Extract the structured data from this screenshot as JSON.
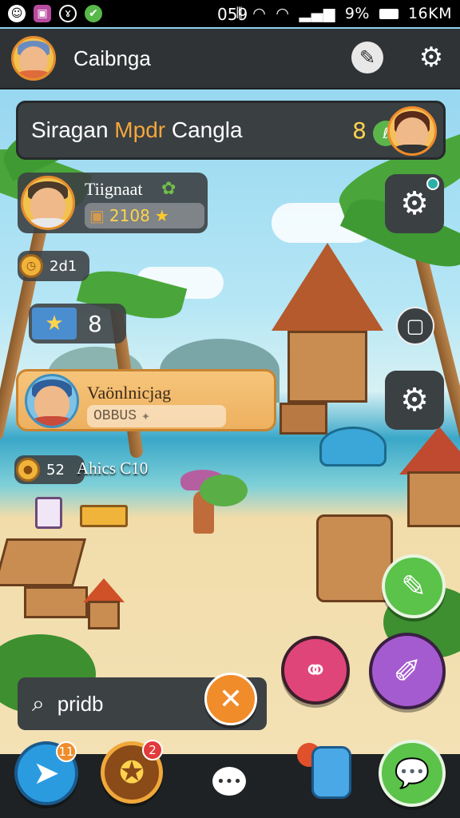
{
  "status_bar": {
    "time": "059",
    "battery_text": "9%",
    "data_text": "16KM"
  },
  "header": {
    "title": "Caibnga"
  },
  "quest_banner": {
    "title_part1": "Siragan ",
    "title_highlight": "Mpdr",
    "title_part2": " Cangla",
    "count": "8"
  },
  "player_card": {
    "name": "Tiignaat",
    "score": "2108"
  },
  "chips": {
    "timer_value": "2d1",
    "item_count": "8",
    "coins_value": "52",
    "coins_label": "Ahics C10"
  },
  "player_card_2": {
    "name": "Vaönlnicjag",
    "subtitle": "OBBUS"
  },
  "search": {
    "value": "pridb"
  },
  "bottom_nav": {
    "item1_badge": "11",
    "item2_badge": "2"
  },
  "colors": {
    "accent_orange": "#f4a63c",
    "accent_green": "#5bc24a",
    "accent_pink": "#e0457a",
    "accent_purple": "#a55bd0",
    "accent_blue": "#2b9be0"
  }
}
